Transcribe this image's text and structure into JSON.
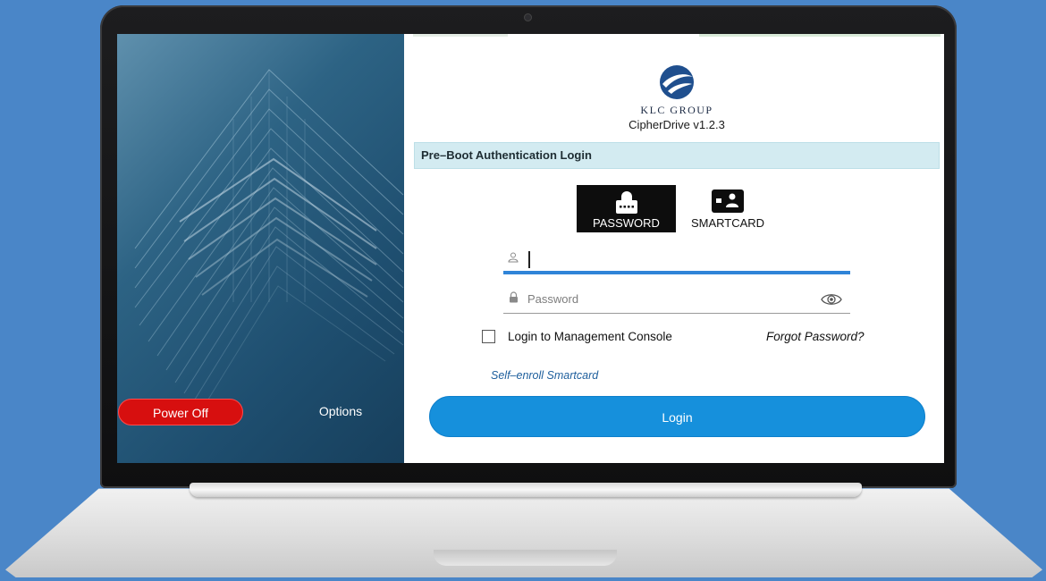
{
  "brand": {
    "company": "KLC GROUP",
    "product": "CipherDrive v1.2.3",
    "logo_icon": "globe-logo-icon"
  },
  "section_header": "Pre–Boot Authentication Login",
  "auth_tabs": [
    {
      "label": "PASSWORD",
      "icon": "keyboard-lock-icon",
      "selected": true
    },
    {
      "label": "SMARTCARD",
      "icon": "smartcard-icon",
      "selected": false
    }
  ],
  "username": {
    "value": "",
    "icon": "user-icon"
  },
  "password": {
    "placeholder": "Password",
    "icon": "lock-icon",
    "toggle_icon": "eye-icon"
  },
  "management_console": {
    "label": "Login to Management Console",
    "checked": false
  },
  "forgot_password": "Forgot Password?",
  "self_enroll": "Self–enroll Smartcard",
  "login_button": "Login",
  "left_panel": {
    "power_off": "Power Off",
    "options": "Options"
  },
  "colors": {
    "accent": "#1690dc",
    "header_bg": "#d3ebf1",
    "power_off": "#d70f0f",
    "panel_dark": "#1e4e6f"
  }
}
